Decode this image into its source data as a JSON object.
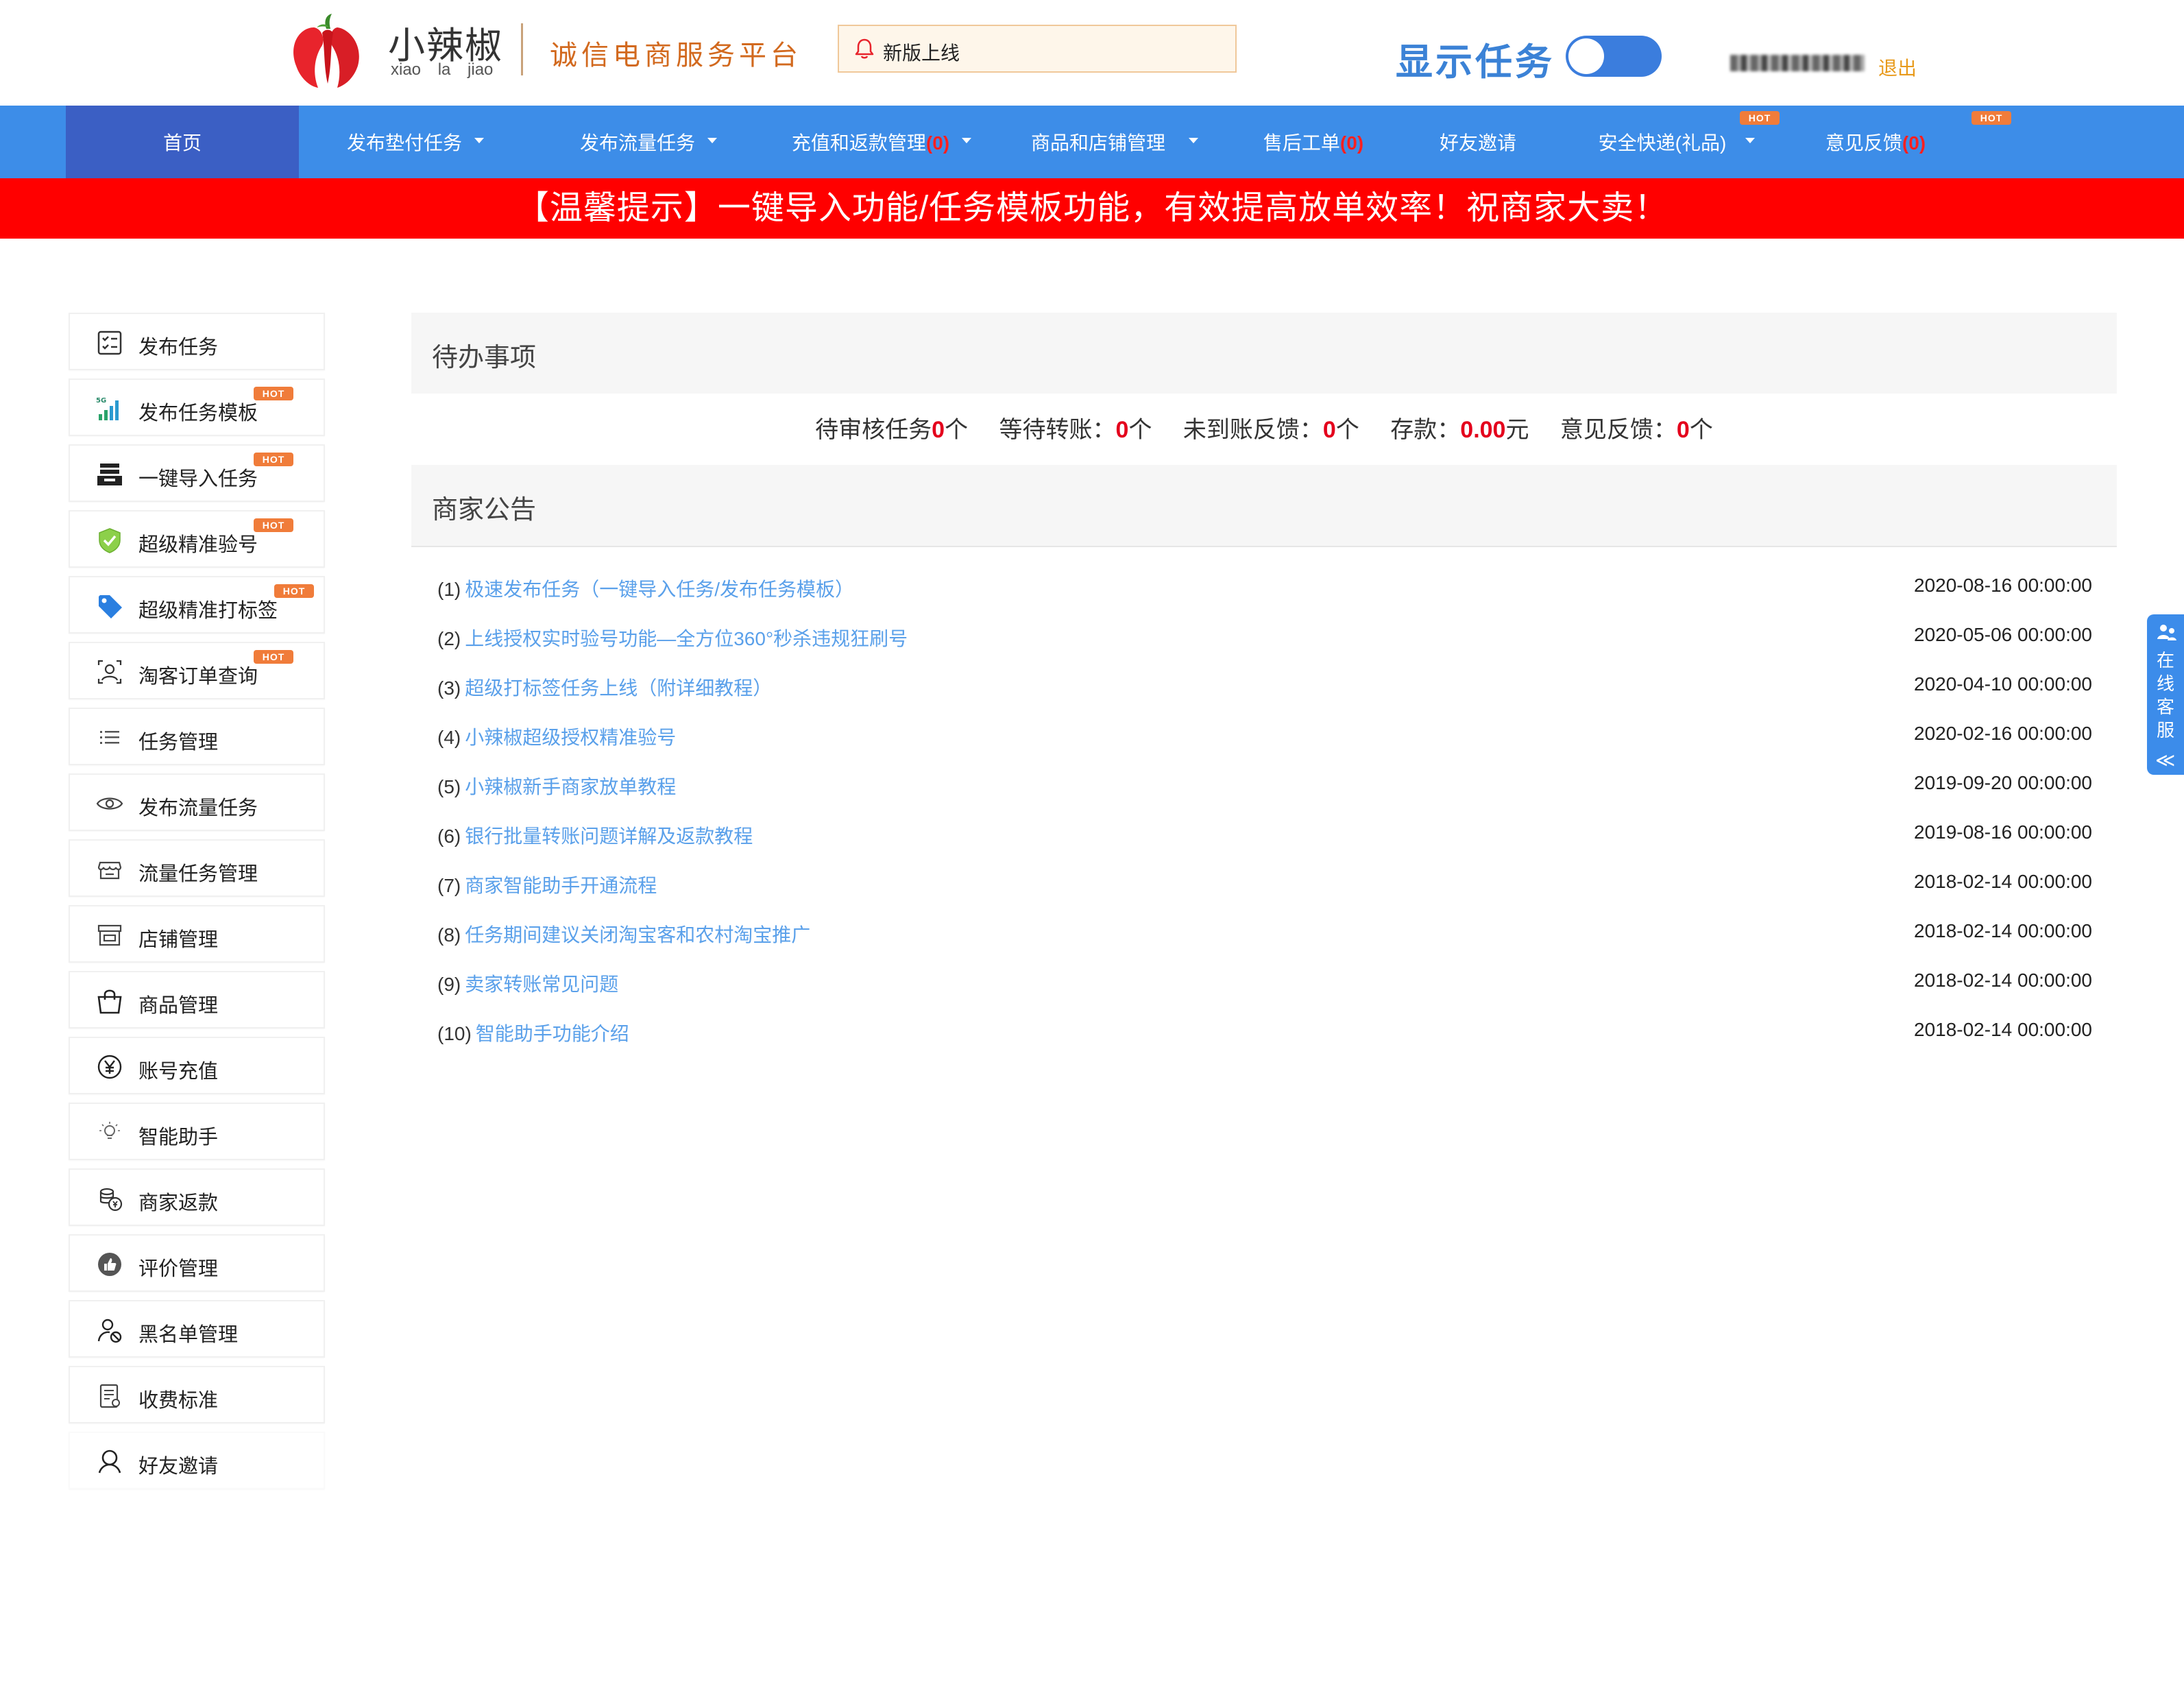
{
  "header": {
    "logo_name": "小辣椒",
    "logo_pinyin": "xiao la jiao",
    "slogan": "诚信电商服务平台",
    "notice": "新版上线",
    "show_task_label": "显示任务",
    "show_task_enabled": true,
    "logout": "退出"
  },
  "nav": {
    "items": [
      {
        "label": "首页",
        "active": true
      },
      {
        "label": "发布垫付任务",
        "dropdown": true
      },
      {
        "label": "发布流量任务",
        "dropdown": true
      },
      {
        "label": "充值和返款管理",
        "count": "(0)",
        "dropdown": true
      },
      {
        "label": "商品和店铺管理",
        "dropdown": true
      },
      {
        "label": "售后工单",
        "count": "(0)"
      },
      {
        "label": "好友邀请"
      },
      {
        "label": "安全快递(礼品)",
        "dropdown": true,
        "hot": "HOT"
      },
      {
        "label": "意见反馈",
        "count": "(0)",
        "hot": "HOT"
      }
    ]
  },
  "banner": "【温馨提示】一键导入功能/任务模板功能，有效提高放单效率！祝商家大卖！",
  "sidebar": {
    "items": [
      {
        "label": "发布任务",
        "icon": "checklist-icon"
      },
      {
        "label": "发布任务模板",
        "icon": "signal-5g-icon",
        "hot": "HOT"
      },
      {
        "label": "一键导入任务",
        "icon": "import-tray-icon",
        "hot": "HOT"
      },
      {
        "label": "超级精准验号",
        "icon": "shield-check-icon",
        "hot": "HOT"
      },
      {
        "label": "超级精准打标签",
        "icon": "tag-icon",
        "hot": "HOT"
      },
      {
        "label": "淘客订单查询",
        "icon": "user-search-icon",
        "hot": "HOT"
      },
      {
        "label": "任务管理",
        "icon": "list-icon"
      },
      {
        "label": "发布流量任务",
        "icon": "eye-icon"
      },
      {
        "label": "流量任务管理",
        "icon": "shop-icon"
      },
      {
        "label": "店铺管理",
        "icon": "store-icon"
      },
      {
        "label": "商品管理",
        "icon": "shopping-bag-icon"
      },
      {
        "label": "账号充值",
        "icon": "yen-icon"
      },
      {
        "label": "智能助手",
        "icon": "lightbulb-icon"
      },
      {
        "label": "商家返款",
        "icon": "coins-icon"
      },
      {
        "label": "评价管理",
        "icon": "thumbs-up-icon"
      },
      {
        "label": "黑名单管理",
        "icon": "user-block-icon"
      },
      {
        "label": "收费标准",
        "icon": "document-icon"
      },
      {
        "label": "好友邀请",
        "icon": "friend-icon"
      }
    ],
    "hot_label": "HOT"
  },
  "todo": {
    "title": "待办事项",
    "pending_review_label": "待审核任务",
    "pending_review_value": "0",
    "pending_review_unit": "个",
    "waiting_transfer_label": "等待转账：",
    "waiting_transfer_value": "0",
    "waiting_transfer_unit": "个",
    "unreceived_label": "未到账反馈：",
    "unreceived_value": "0",
    "unreceived_unit": "个",
    "deposit_label": "存款：",
    "deposit_value": "0.00",
    "deposit_unit": "元",
    "feedback_label": "意见反馈：",
    "feedback_value": "0",
    "feedback_unit": "个"
  },
  "announcements": {
    "title": "商家公告",
    "items": [
      {
        "num": "(1)",
        "title": "极速发布任务（一键导入任务/发布任务模板）",
        "date": "2020-08-16 00:00:00"
      },
      {
        "num": "(2)",
        "title": "上线授权实时验号功能—全方位360°秒杀违规狂刷号",
        "date": "2020-05-06 00:00:00"
      },
      {
        "num": "(3)",
        "title": "超级打标签任务上线（附详细教程）",
        "date": "2020-04-10 00:00:00"
      },
      {
        "num": "(4)",
        "title": "小辣椒超级授权精准验号",
        "date": "2020-02-16 00:00:00"
      },
      {
        "num": "(5)",
        "title": "小辣椒新手商家放单教程",
        "date": "2019-09-20 00:00:00"
      },
      {
        "num": "(6)",
        "title": "银行批量转账问题详解及返款教程",
        "date": "2019-08-16 00:00:00"
      },
      {
        "num": "(7)",
        "title": "商家智能助手开通流程",
        "date": "2018-02-14 00:00:00"
      },
      {
        "num": "(8)",
        "title": "任务期间建议关闭淘宝客和农村淘宝推广",
        "date": "2018-02-14 00:00:00"
      },
      {
        "num": "(9)",
        "title": "卖家转账常见问题",
        "date": "2018-02-14 00:00:00"
      },
      {
        "num": "(10)",
        "title": "智能助手功能介绍",
        "date": "2018-02-14 00:00:00"
      }
    ]
  },
  "service": {
    "label": "在线客服",
    "arrow": "≪"
  },
  "colors": {
    "nav": "#3d8de8",
    "nav_active": "#3b5fc4",
    "banner": "#ff0000",
    "link": "#5aa0ea",
    "alert": "#e4001c",
    "hot": "#f07c3a"
  }
}
